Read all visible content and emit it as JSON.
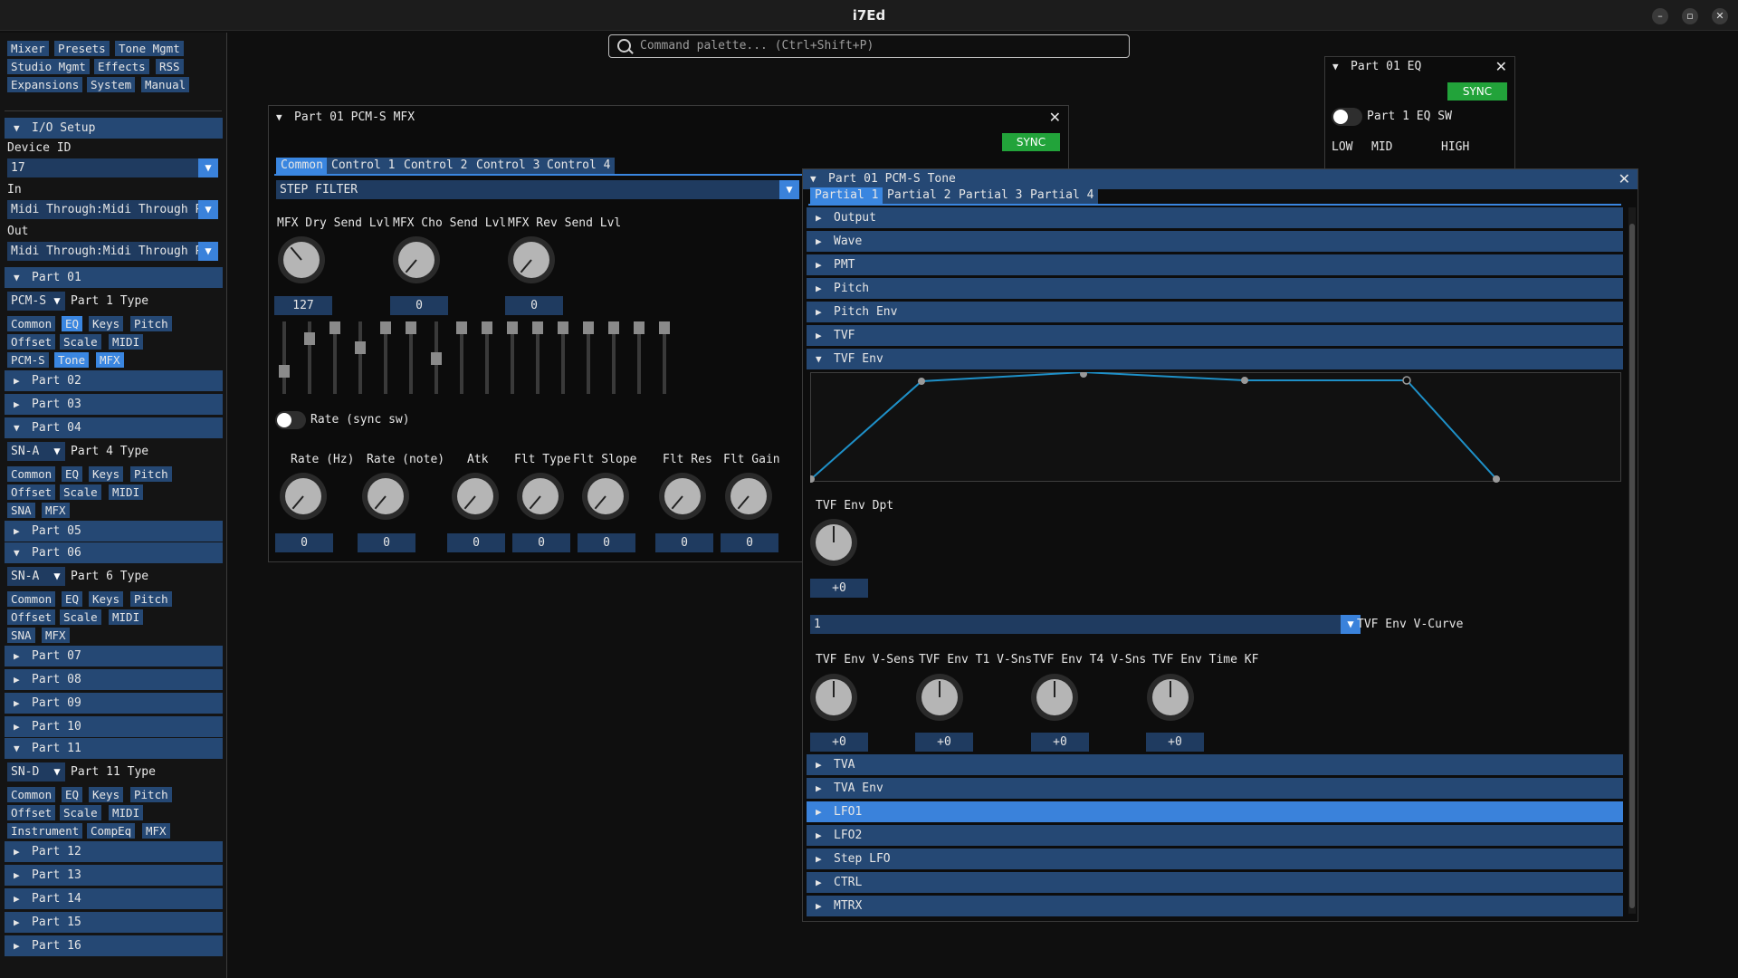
{
  "app": {
    "title": "i7Ed",
    "win_min": "–",
    "win_max": "▫",
    "win_close": "✕"
  },
  "palette": {
    "placeholder": "Command palette...  (Ctrl+Shift+P)"
  },
  "menu": [
    "Mixer",
    "Presets",
    "Tone Mgmt",
    "Studio Mgmt",
    "Effects",
    "RSS",
    "Expansions",
    "System",
    "Manual"
  ],
  "io": {
    "header": "I/O Setup",
    "device_id_label": "Device ID",
    "device_id": "17",
    "in_label": "In",
    "in_value": "Midi Through:Midi Through Port",
    "out_label": "Out",
    "out_value": "Midi Through:Midi Through Port"
  },
  "parts": {
    "p01": {
      "header": "Part 01",
      "type_value": "PCM-S",
      "type_label": "Part 1 Type",
      "buttons": [
        "Common",
        "EQ",
        "Keys",
        "Pitch",
        "Offset",
        "Scale",
        "MIDI",
        "PCM-S",
        "Tone",
        "MFX"
      ]
    },
    "p02": "Part 02",
    "p03": "Part 03",
    "p04": {
      "header": "Part 04",
      "type_value": "SN-A",
      "type_label": "Part 4 Type",
      "buttons": [
        "Common",
        "EQ",
        "Keys",
        "Pitch",
        "Offset",
        "Scale",
        "MIDI",
        "SNA",
        "MFX"
      ]
    },
    "p05": "Part 05",
    "p06": {
      "header": "Part 06",
      "type_value": "SN-A",
      "type_label": "Part 6 Type",
      "buttons": [
        "Common",
        "EQ",
        "Keys",
        "Pitch",
        "Offset",
        "Scale",
        "MIDI",
        "SNA",
        "MFX"
      ]
    },
    "p07": "Part 07",
    "p08": "Part 08",
    "p09": "Part 09",
    "p10": "Part 10",
    "p11": {
      "header": "Part 11",
      "type_value": "SN-D",
      "type_label": "Part 11 Type",
      "buttons": [
        "Common",
        "EQ",
        "Keys",
        "Pitch",
        "Offset",
        "Scale",
        "MIDI",
        "Instrument",
        "CompEq",
        "MFX"
      ]
    },
    "p12": "Part 12",
    "p13": "Part 13",
    "p14": "Part 14",
    "p15": "Part 15",
    "p16": "Part 16"
  },
  "mfx": {
    "title": "Part 01 PCM-S MFX",
    "sync": "SYNC",
    "tabs": [
      "Common",
      "Control 1",
      "Control 2",
      "Control 3",
      "Control 4"
    ],
    "type": "STEP FILTER",
    "send": [
      {
        "label": "MFX Dry Send Lvl",
        "value": "127"
      },
      {
        "label": "MFX Cho Send Lvl",
        "value": "0"
      },
      {
        "label": "MFX Rev Send Lvl",
        "value": "0"
      }
    ],
    "rate_toggle": "Rate (sync sw)",
    "params": [
      {
        "label": "Rate (Hz)",
        "value": "0"
      },
      {
        "label": "Rate (note)",
        "value": "0"
      },
      {
        "label": "Atk",
        "value": "0"
      },
      {
        "label": "Flt Type",
        "value": "0"
      },
      {
        "label": "Flt Slope",
        "value": "0"
      },
      {
        "label": "Flt Res",
        "value": "0"
      },
      {
        "label": "Flt Gain",
        "value": "0"
      }
    ]
  },
  "eq": {
    "title": "Part 01 EQ",
    "sync": "SYNC",
    "sw_label": "Part 1 EQ SW",
    "low": "LOW",
    "mid": "MID",
    "high": "HIGH"
  },
  "tone": {
    "title": "Part 01 PCM-S Tone",
    "tabs": [
      "Partial 1",
      "Partial 2",
      "Partial 3",
      "Partial 4"
    ],
    "sections_top": [
      "Output",
      "Wave",
      "PMT",
      "Pitch",
      "Pitch Env"
    ],
    "tvf": "TVF",
    "tvf_env": "TVF Env",
    "depth": {
      "label": "TVF Env Dpt",
      "value": "+0"
    },
    "vcurve": {
      "value": "1",
      "label": "TVF Env V-Curve"
    },
    "knobs": [
      {
        "label": "TVF Env V-Sens",
        "value": "+0"
      },
      {
        "label": "TVF Env T1 V-Sns",
        "value": "+0"
      },
      {
        "label": "TVF Env T4 V-Sns",
        "value": "+0"
      },
      {
        "label": "TVF Env Time KF",
        "value": "+0"
      }
    ],
    "sections_bottom": [
      "TVA",
      "TVA Env",
      "LFO1",
      "LFO2",
      "Step LFO",
      "CTRL",
      "MTRX"
    ],
    "selected": "LFO1",
    "accent": "#3a82db"
  },
  "colors": {
    "header": "#254874",
    "active": "#3a86e0",
    "sync": "#22a33a",
    "env_line": "#1e90c8"
  }
}
